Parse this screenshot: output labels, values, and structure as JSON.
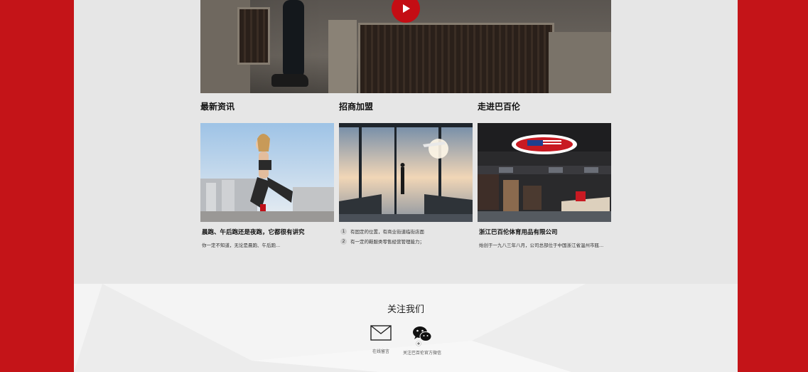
{
  "colors": {
    "brand_red": "#c41418",
    "page_bg": "#e6e6e6",
    "footer_bg": "#f4f4f4"
  },
  "video": {
    "play_icon": "play-icon"
  },
  "columns": [
    {
      "title": "最新资讯",
      "item_title": "晨跑、午后跑还是夜跑，它都很有讲究",
      "item_desc": "你一定不知道，无论是晨跑、午后跑..."
    },
    {
      "title": "招商加盟",
      "list": [
        {
          "num": "1",
          "text": "有固定的位置，有商业街道临街店面"
        },
        {
          "num": "2",
          "text": "有一定的鞋服类零售经营管理能力；"
        }
      ]
    },
    {
      "title": "走进巴百伦",
      "item_title": "浙江巴百伦体育用品有限公司",
      "item_desc": "始创于一九八三年八月，公司总部位于中国浙江省温州市瓯..."
    }
  ],
  "footer": {
    "title": "关注我们",
    "items": [
      {
        "label": "在线留言",
        "icon": "mail-icon"
      },
      {
        "label": "关注巴百伦官方微信",
        "icon": "wechat-icon"
      }
    ]
  }
}
